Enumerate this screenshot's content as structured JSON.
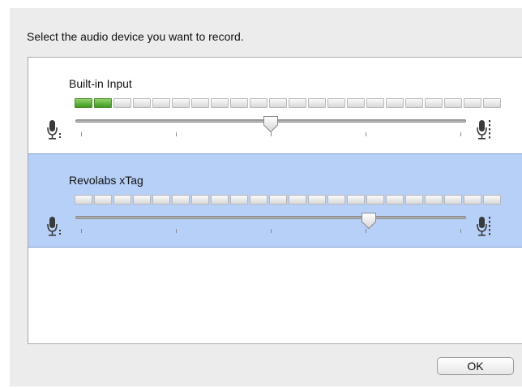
{
  "dialog": {
    "prompt": "Select the audio device you want to record.",
    "ok_label": "OK"
  },
  "devices": [
    {
      "name": "Built-in Input",
      "selected": false,
      "meter_segments_total": 22,
      "meter_segments_lit": 2,
      "gain_fraction": 0.5
    },
    {
      "name": "Revolabs xTag",
      "selected": true,
      "meter_segments_total": 22,
      "meter_segments_lit": 0,
      "gain_fraction": 0.75
    }
  ],
  "colors": {
    "selection": "#b7d0f7",
    "meter_on": "#3e9b20",
    "meter_off": "#e2e2e2"
  },
  "icons": {
    "low": "microphone-low-icon",
    "high": "microphone-high-icon"
  }
}
